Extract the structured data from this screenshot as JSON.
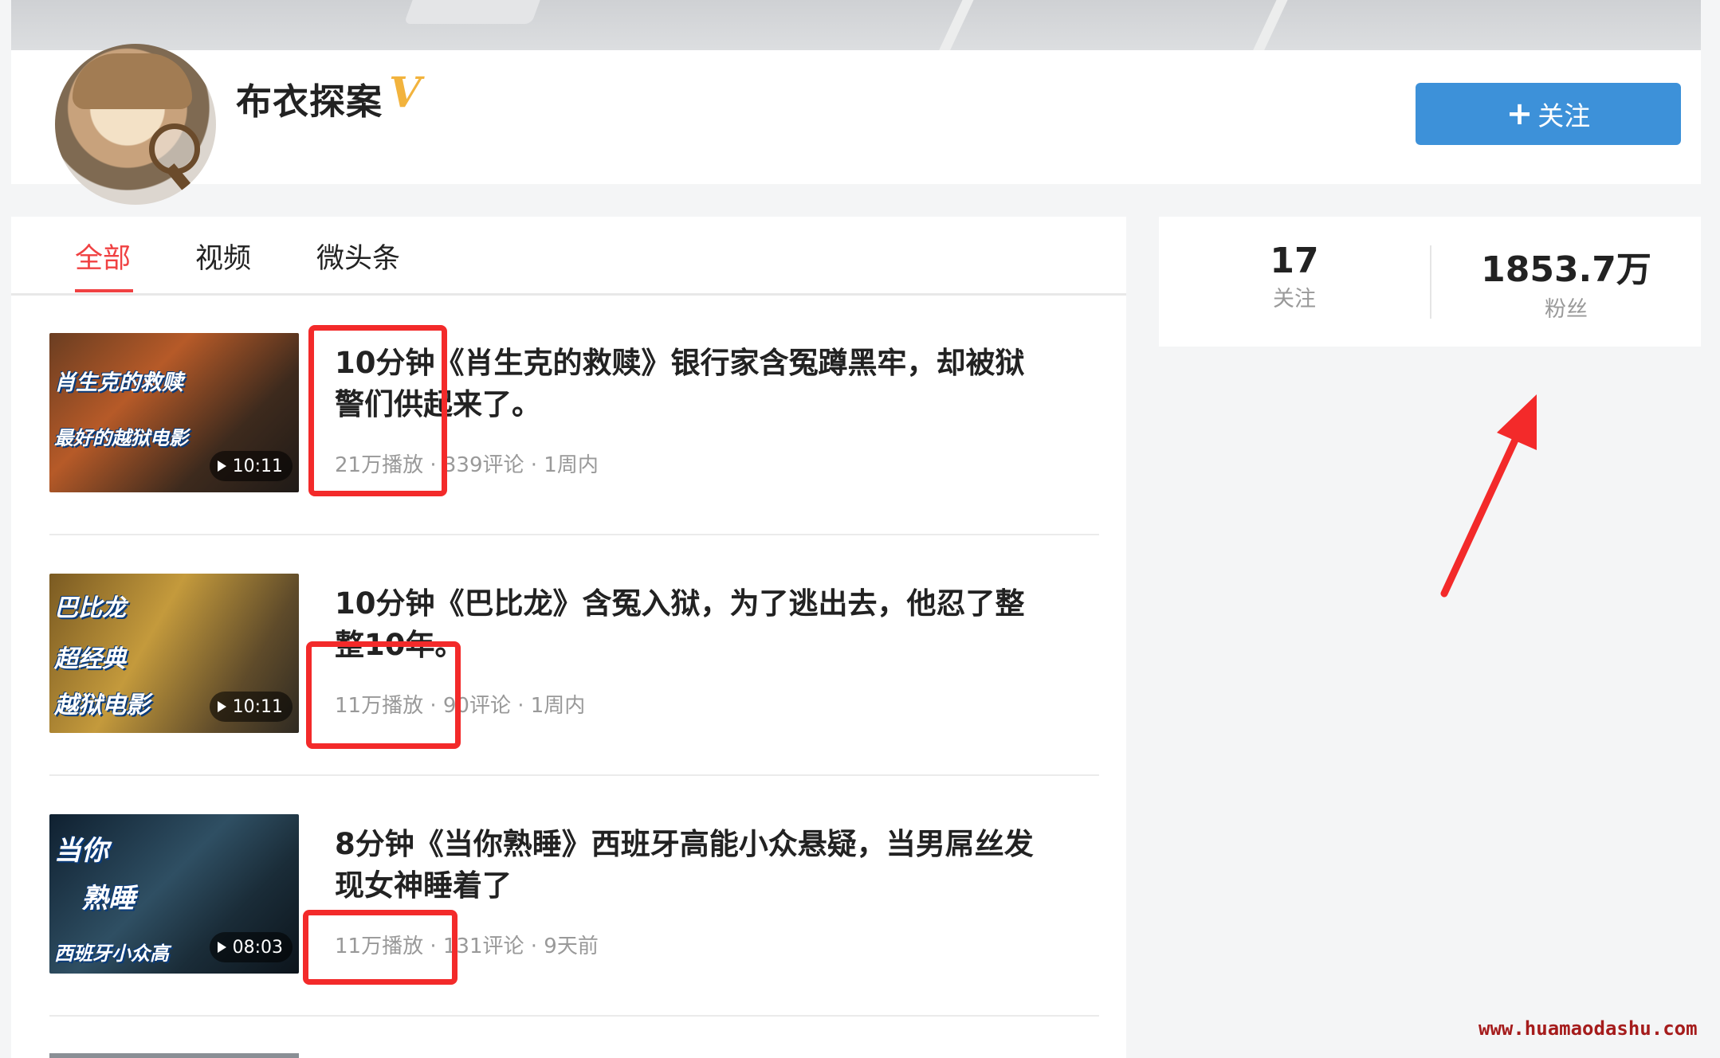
{
  "profile": {
    "name": "布衣探案",
    "verified_mark": "V",
    "follow_button": "关注",
    "follow_plus": "+"
  },
  "tabs": [
    {
      "label": "全部",
      "active": true
    },
    {
      "label": "视频",
      "active": false
    },
    {
      "label": "微头条",
      "active": false
    }
  ],
  "feed": [
    {
      "thumb_text": [
        "肖生克的救赎",
        "最好的越狱电影"
      ],
      "duration": "10:11",
      "title_line1": "10分钟《肖生克的救赎》银行家含冤蹲黑牢，却被狱",
      "title_line2": "警们供起来了。",
      "meta": "21万播放 · 339评论 · 1周内"
    },
    {
      "thumb_text": [
        "巴比龙",
        "超经典",
        "越狱电影"
      ],
      "duration": "10:11",
      "title_line1": "10分钟《巴比龙》含冤入狱，为了逃出去，他忍了整",
      "title_line2": "整10年。",
      "meta": "11万播放 · 90评论 · 1周内"
    },
    {
      "thumb_text": [
        "当你",
        "熟睡",
        "西班牙小众高"
      ],
      "duration": "08:03",
      "title_line1": "8分钟《当你熟睡》西班牙高能小众悬疑，当男屌丝发",
      "title_line2": "现女神睡着了",
      "meta": "11万播放 · 131评论 · 9天前"
    }
  ],
  "stats": {
    "following_count": "17",
    "following_label": "关注",
    "fans_count": "1853.7万",
    "fans_label": "粉丝"
  },
  "watermark": "www.huamaodashu.com",
  "colors": {
    "accent_red": "#f04142",
    "follow_blue": "#3d91d9",
    "annotation_red": "#f32a2a",
    "verified_gold": "#f2b33d"
  }
}
